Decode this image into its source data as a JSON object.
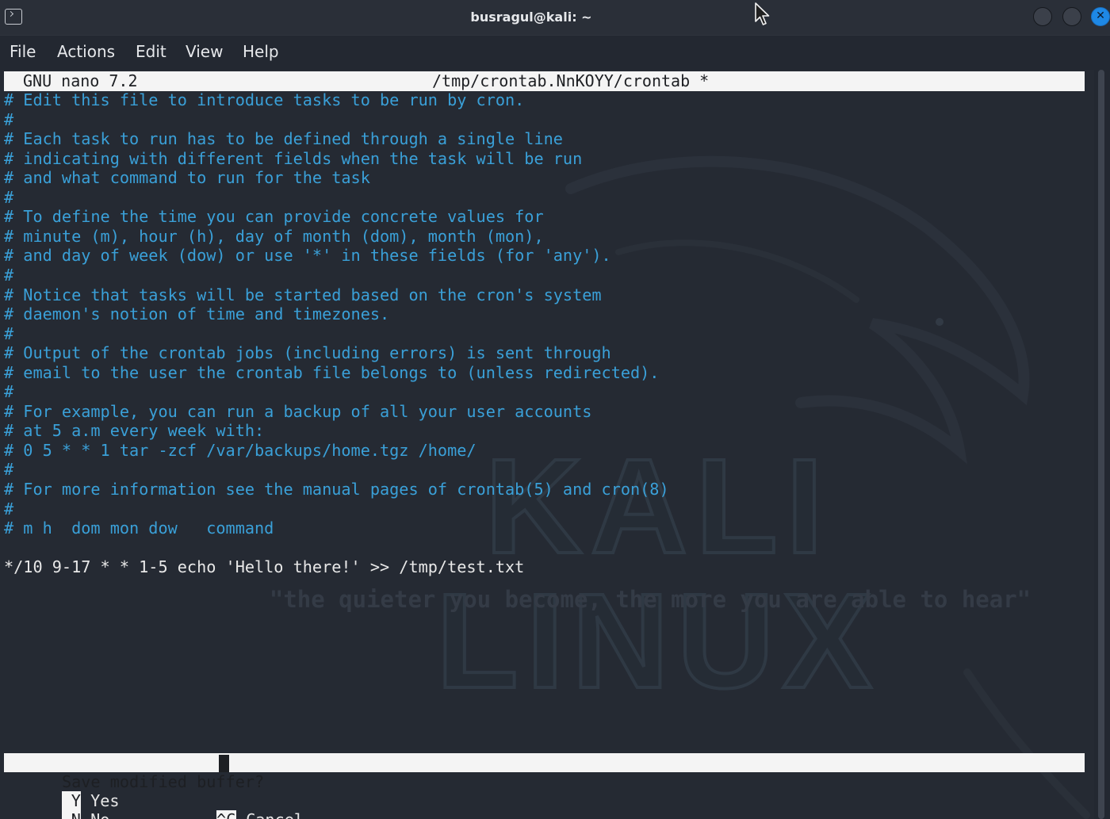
{
  "window": {
    "title": "busragul@kali: ~"
  },
  "menu": {
    "items": [
      "File",
      "Actions",
      "Edit",
      "View",
      "Help"
    ]
  },
  "nano": {
    "version": "GNU nano 7.2",
    "filename": "/tmp/crontab.NnKOYY/crontab *"
  },
  "lines": [
    {
      "text": "# Edit this file to introduce tasks to be run by cron.",
      "style": "comment"
    },
    {
      "text": "#",
      "style": "comment"
    },
    {
      "text": "# Each task to run has to be defined through a single line",
      "style": "comment"
    },
    {
      "text": "# indicating with different fields when the task will be run",
      "style": "comment"
    },
    {
      "text": "# and what command to run for the task",
      "style": "comment"
    },
    {
      "text": "#",
      "style": "comment"
    },
    {
      "text": "# To define the time you can provide concrete values for",
      "style": "comment"
    },
    {
      "text": "# minute (m), hour (h), day of month (dom), month (mon),",
      "style": "comment"
    },
    {
      "text": "# and day of week (dow) or use '*' in these fields (for 'any').",
      "style": "comment"
    },
    {
      "text": "#",
      "style": "comment"
    },
    {
      "text": "# Notice that tasks will be started based on the cron's system",
      "style": "comment"
    },
    {
      "text": "# daemon's notion of time and timezones.",
      "style": "comment"
    },
    {
      "text": "#",
      "style": "comment"
    },
    {
      "text": "# Output of the crontab jobs (including errors) is sent through",
      "style": "comment"
    },
    {
      "text": "# email to the user the crontab file belongs to (unless redirected).",
      "style": "comment"
    },
    {
      "text": "#",
      "style": "comment"
    },
    {
      "text": "# For example, you can run a backup of all your user accounts",
      "style": "comment"
    },
    {
      "text": "# at 5 a.m every week with:",
      "style": "comment"
    },
    {
      "text": "# 0 5 * * 1 tar -zcf /var/backups/home.tgz /home/",
      "style": "comment"
    },
    {
      "text": "#",
      "style": "comment"
    },
    {
      "text": "# For more information see the manual pages of crontab(5) and cron(8)",
      "style": "comment"
    },
    {
      "text": "#",
      "style": "comment"
    },
    {
      "text": "# m h  dom mon dow   command",
      "style": "comment"
    },
    {
      "text": "",
      "style": "plain"
    },
    {
      "text": "*/10 9-17 * * 1-5 echo 'Hello there!' >> /tmp/test.txt",
      "style": "plain"
    }
  ],
  "watermark": {
    "logo": "KALI LINUX",
    "quote": "\"the quieter you become, the more you are able to hear\""
  },
  "prompt": {
    "question": "Save modified buffer? "
  },
  "options": {
    "yes": {
      "key": "Y",
      "label": "Yes"
    },
    "no": {
      "key": "N",
      "label": "No"
    },
    "cancel": {
      "key": "^C",
      "label": "Cancel"
    }
  },
  "colors": {
    "comment": "#3aa0d8",
    "accent": "#1e88e5",
    "background": "#252a33"
  }
}
